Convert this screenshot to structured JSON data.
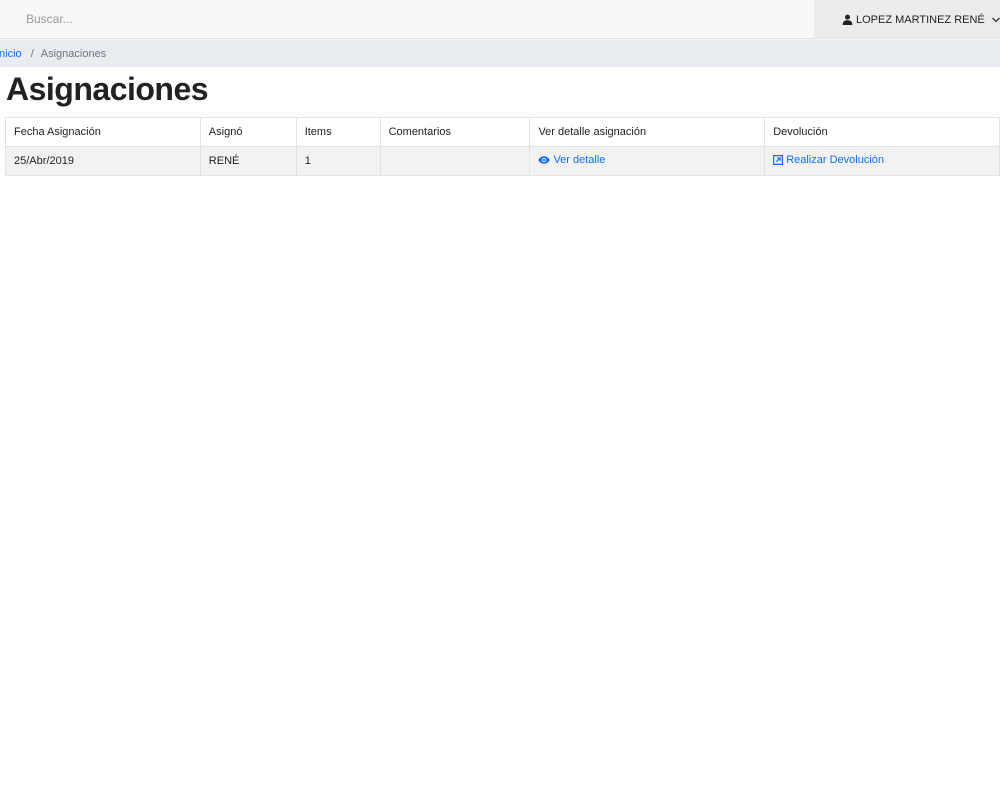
{
  "search": {
    "placeholder": "Buscar..."
  },
  "user_menu": {
    "name": "LOPEZ MARTINEZ RENÉ",
    "icon": "user-icon",
    "dropdown_icon": "chevron-down-icon"
  },
  "breadcrumb": {
    "home": "Inicio",
    "separator": "/",
    "current": "Asignaciones"
  },
  "page": {
    "title": "Asignaciones"
  },
  "table": {
    "headers": [
      "Fecha Asignación",
      "Asignó",
      "Items",
      "Comentarios",
      "Ver detalle asignación",
      "Devolución"
    ],
    "rows": [
      {
        "fecha": "25/Abr/2019",
        "asigno": "RENÉ",
        "items": "1",
        "comentarios": "",
        "ver_detalle": "Ver detalle",
        "devolucion": "Realizar Devolución"
      }
    ]
  },
  "colors": {
    "link": "#0d6efd",
    "breadcrumb_bg": "#e9edf1",
    "row_bg": "#f2f2f2"
  }
}
